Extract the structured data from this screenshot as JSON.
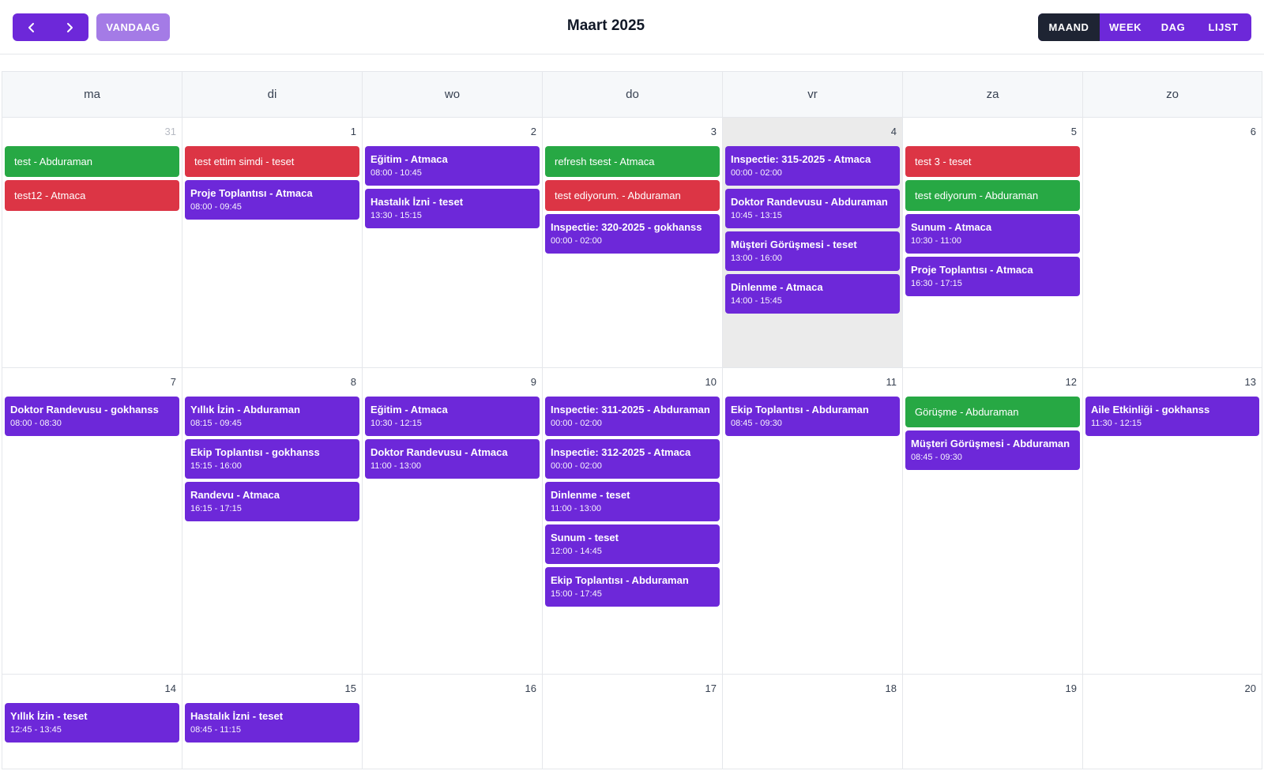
{
  "toolbar": {
    "prev_icon": "chevron-left-icon",
    "next_icon": "chevron-right-icon",
    "today_label": "VANDAAG",
    "title": "Maart 2025",
    "views": [
      {
        "label": "MAAND",
        "active": true
      },
      {
        "label": "WEEK",
        "active": false
      },
      {
        "label": "DAG",
        "active": false
      },
      {
        "label": "LIJST",
        "active": false
      }
    ]
  },
  "colors": {
    "primary": "#6d28d9",
    "today_button": "#a47be6",
    "active_view": "#1e2433",
    "green": "#27a844",
    "red": "#dc3545",
    "today_cell": "#ebebeb"
  },
  "weekdays": [
    "ma",
    "di",
    "wo",
    "do",
    "vr",
    "za",
    "zo"
  ],
  "weeks": [
    {
      "days": [
        {
          "num": "31",
          "muted": true,
          "events": [
            {
              "kind": "green",
              "title": "test - Abduraman"
            },
            {
              "kind": "red",
              "title": "test12 - Atmaca"
            }
          ]
        },
        {
          "num": "1",
          "events": [
            {
              "kind": "red",
              "title": "test ettim simdi - teset"
            },
            {
              "kind": "purple",
              "title": "Proje Toplantısı - Atmaca",
              "time": "08:00 - 09:45"
            }
          ]
        },
        {
          "num": "2",
          "events": [
            {
              "kind": "purple",
              "title": "Eğitim - Atmaca",
              "time": "08:00 - 10:45"
            },
            {
              "kind": "purple",
              "title": "Hastalık İzni - teset",
              "time": "13:30 - 15:15"
            }
          ]
        },
        {
          "num": "3",
          "events": [
            {
              "kind": "green",
              "title": "refresh tsest - Atmaca"
            },
            {
              "kind": "red",
              "title": "test ediyorum. - Abduraman"
            },
            {
              "kind": "purple",
              "title": "Inspectie: 320-2025 - gokhanss",
              "time": "00:00 - 02:00"
            }
          ]
        },
        {
          "num": "4",
          "today": true,
          "events": [
            {
              "kind": "purple",
              "title": "Inspectie: 315-2025 - Atmaca",
              "time": "00:00 - 02:00"
            },
            {
              "kind": "purple",
              "title": "Doktor Randevusu - Abduraman",
              "time": "10:45 - 13:15"
            },
            {
              "kind": "purple",
              "title": "Müşteri Görüşmesi - teset",
              "time": "13:00 - 16:00"
            },
            {
              "kind": "purple",
              "title": "Dinlenme - Atmaca",
              "time": "14:00 - 15:45"
            }
          ]
        },
        {
          "num": "5",
          "events": [
            {
              "kind": "red",
              "title": "test 3 - teset"
            },
            {
              "kind": "green",
              "title": "test ediyorum - Abduraman"
            },
            {
              "kind": "purple",
              "title": "Sunum - Atmaca",
              "time": "10:30 - 11:00"
            },
            {
              "kind": "purple",
              "title": "Proje Toplantısı - Atmaca",
              "time": "16:30 - 17:15"
            }
          ]
        },
        {
          "num": "6",
          "events": []
        }
      ]
    },
    {
      "days": [
        {
          "num": "7",
          "events": [
            {
              "kind": "purple",
              "title": "Doktor Randevusu - gokhanss",
              "time": "08:00 - 08:30"
            }
          ]
        },
        {
          "num": "8",
          "events": [
            {
              "kind": "purple",
              "title": "Yıllık İzin - Abduraman",
              "time": "08:15 - 09:45"
            },
            {
              "kind": "purple",
              "title": "Ekip Toplantısı - gokhanss",
              "time": "15:15 - 16:00"
            },
            {
              "kind": "purple",
              "title": "Randevu - Atmaca",
              "time": "16:15 - 17:15"
            }
          ]
        },
        {
          "num": "9",
          "events": [
            {
              "kind": "purple",
              "title": "Eğitim - Atmaca",
              "time": "10:30 - 12:15"
            },
            {
              "kind": "purple",
              "title": "Doktor Randevusu - Atmaca",
              "time": "11:00 - 13:00"
            }
          ]
        },
        {
          "num": "10",
          "events": [
            {
              "kind": "purple",
              "title": "Inspectie: 311-2025 - Abduraman",
              "time": "00:00 - 02:00"
            },
            {
              "kind": "purple",
              "title": "Inspectie: 312-2025 - Atmaca",
              "time": "00:00 - 02:00"
            },
            {
              "kind": "purple",
              "title": "Dinlenme - teset",
              "time": "11:00 - 13:00"
            },
            {
              "kind": "purple",
              "title": "Sunum - teset",
              "time": "12:00 - 14:45"
            },
            {
              "kind": "purple",
              "title": "Ekip Toplantısı - Abduraman",
              "time": "15:00 - 17:45"
            }
          ]
        },
        {
          "num": "11",
          "events": [
            {
              "kind": "purple",
              "title": "Ekip Toplantısı - Abduraman",
              "time": "08:45 - 09:30"
            }
          ]
        },
        {
          "num": "12",
          "events": [
            {
              "kind": "green",
              "title": "Görüşme - Abduraman"
            },
            {
              "kind": "purple",
              "title": "Müşteri Görüşmesi - Abduraman",
              "time": "08:45 - 09:30"
            }
          ]
        },
        {
          "num": "13",
          "events": [
            {
              "kind": "purple",
              "title": "Aile Etkinliği - gokhanss",
              "time": "11:30 - 12:15"
            }
          ]
        }
      ]
    },
    {
      "days": [
        {
          "num": "14",
          "events": [
            {
              "kind": "purple",
              "title": "Yıllık İzin - teset",
              "time": "12:45 - 13:45"
            }
          ]
        },
        {
          "num": "15",
          "events": [
            {
              "kind": "purple",
              "title": "Hastalık İzni - teset",
              "time": "08:45 - 11:15"
            }
          ]
        },
        {
          "num": "16",
          "events": []
        },
        {
          "num": "17",
          "events": []
        },
        {
          "num": "18",
          "events": []
        },
        {
          "num": "19",
          "events": []
        },
        {
          "num": "20",
          "events": []
        }
      ]
    }
  ]
}
